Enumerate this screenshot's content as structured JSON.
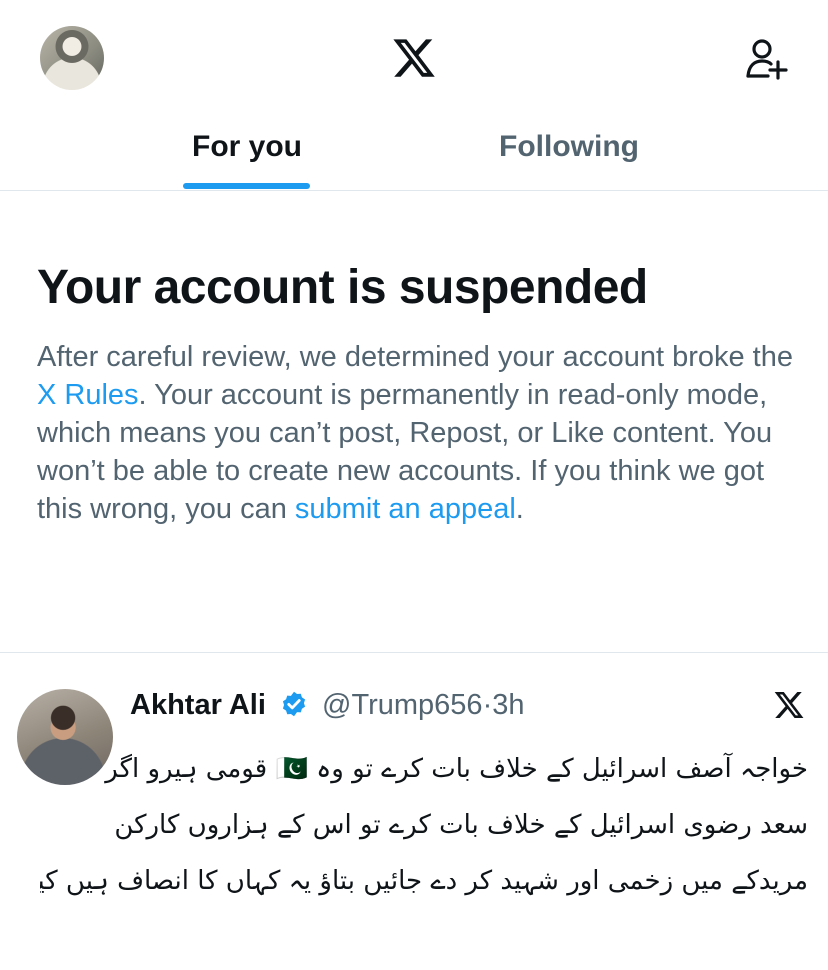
{
  "header": {
    "logo_icon": "x-logo-icon",
    "profile_icon": "avatar",
    "follow_icon": "add-user-icon"
  },
  "tabs": [
    {
      "label": "For you",
      "active": true
    },
    {
      "label": "Following",
      "active": false
    }
  ],
  "notice": {
    "title": "Your account is suspended",
    "text_1": "After careful review, we determined your account broke the ",
    "rules_link": "X Rules",
    "text_2": ". Your account is permanently in read-only mode, which means you can’t post, Repost, or Like content. You won’t be able to create new accounts. If you think we got this wrong, you can ",
    "appeal_link": "submit an appeal",
    "text_3": "."
  },
  "tweet": {
    "name": "Akhtar Ali",
    "verified_icon": "verified-badge-icon",
    "handle": "@Trump656",
    "separator": "·",
    "time": "3h",
    "source_icon": "x-logo-icon",
    "lines": [
      "خواجہ آصف اسرائیل کے خلاف بات کرے تو وہ 🇵🇰 قومی ہیرو اگر",
      "سعد رضوی اسرائیل کے خلاف بات کرے تو اس کے ہزاروں کارکن",
      "مریدکے میں زخمی اور شہید کر دے جائیں بتاؤ یہ کہاں کا انصاف ہیں کیا"
    ]
  },
  "colors": {
    "accent": "#1d9bf0",
    "text_primary": "#0f1419",
    "text_secondary": "#536471",
    "divider": "#e1e8ed"
  }
}
